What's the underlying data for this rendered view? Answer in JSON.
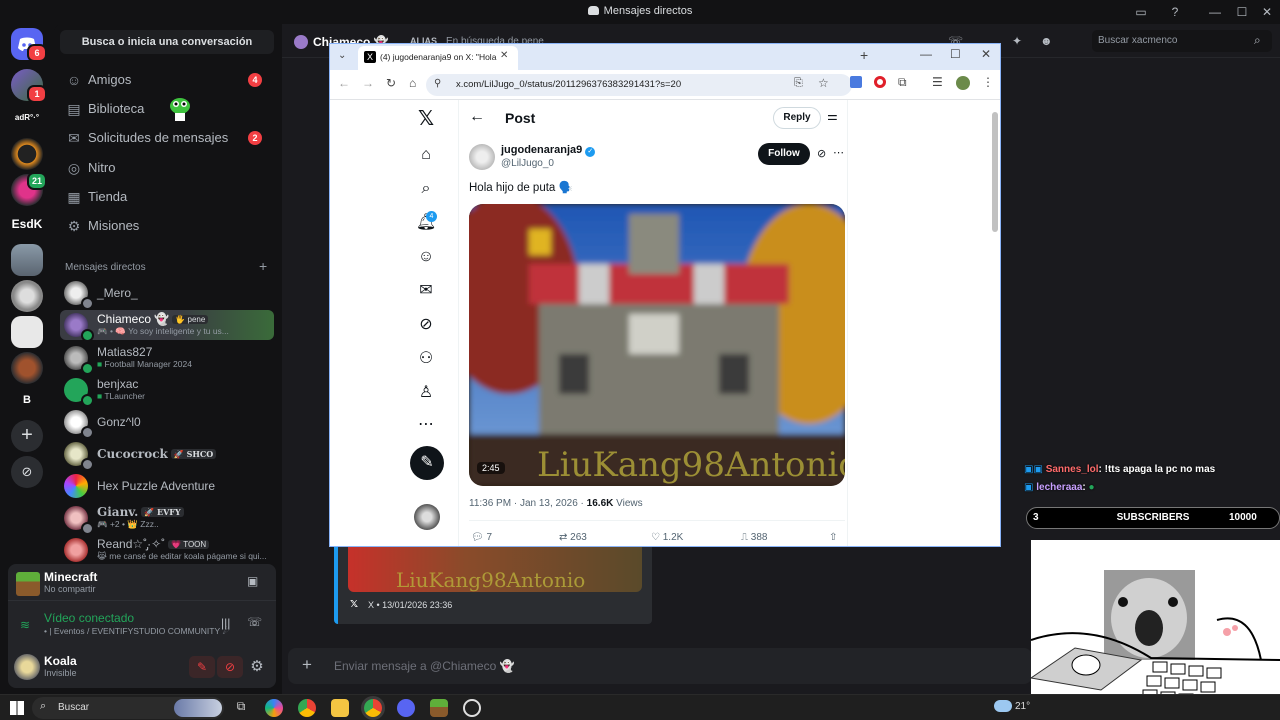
{
  "window": {
    "title": "Mensajes directos"
  },
  "rail": {
    "badges": [
      "6",
      "1",
      "21"
    ],
    "labels": [
      "adR°·°",
      "EsdK",
      "B"
    ]
  },
  "sidebar": {
    "search_label": "Busca o inicia una conversación",
    "nav": [
      {
        "label": "Amigos",
        "badge": "4"
      },
      {
        "label": "Biblioteca"
      },
      {
        "label": "Solicitudes de mensajes",
        "badge": "2"
      },
      {
        "label": "Nitro"
      },
      {
        "label": "Tienda"
      },
      {
        "label": "Misiones"
      }
    ],
    "dm_header": "Mensajes directos",
    "dms": [
      {
        "name": "_Mero_"
      },
      {
        "name": "Chiameco 👻",
        "tag": "🖐 pene",
        "sub": "🎮 • 🧠 Yo soy inteligente y tu us..."
      },
      {
        "name": "Matias827",
        "sub": "Football Manager 2024"
      },
      {
        "name": "benjxac",
        "sub": "TLauncher"
      },
      {
        "name": "Gonz^l0"
      },
      {
        "name": "Cucocrock",
        "tag": "🚀 SHCO"
      },
      {
        "name": "Hex Puzzle Adventure"
      },
      {
        "name": "Gianv.",
        "tag": "🚀 EVFY",
        "sub": "🎮 +2 • 👑 Zzz.."
      },
      {
        "name": "Reand☆˚̡·✧˚",
        "tag": "💗 TOON",
        "sub": "😹 me cansé de editar koala págame si qui..."
      }
    ]
  },
  "panel": {
    "game": "Minecraft",
    "game_sub": "No compartir",
    "voice_title": "Vídeo conectado",
    "voice_sub": "• | Eventos / EVENTIFYSTUDIO COMMUNITY ☄",
    "user": "Koala",
    "status": "Invisible"
  },
  "main": {
    "channel_name": "Chiameco 👻",
    "alias_label": "ALIAS",
    "alias_value": "En búsqueda de pene",
    "search_placeholder": "Buscar xacmenco",
    "message_placeholder": "Enviar mensaje a @Chiameco 👻",
    "embed_footer": "X • 13/01/2026 23:36",
    "embed_watermark": "LiuKang98Antonio"
  },
  "browser": {
    "tab_title": "(4) jugodenaranja9 on X: \"Hola",
    "url": "x.com/LilJugo_0/status/2011296376383291431?s=20",
    "page_title": "Post",
    "reply_label": "Reply",
    "author_name": "jugodenaranja9",
    "author_handle": "@LilJugo_0",
    "follow_label": "Follow",
    "tweet_text": "Hola hijo de puta 🗣️",
    "video_duration": "2:45",
    "video_watermark": "LiuKang98Antonio",
    "timestamp": "11:36 PM · Jan 13, 2026 ·",
    "views_count": "16.6K",
    "views_label": "Views",
    "notif_badge": "4",
    "actions": {
      "replies": "7",
      "reposts": "263",
      "likes": "1.2K",
      "bookmarks": "388"
    }
  },
  "overlay": {
    "chat": [
      {
        "user": "Sannes_lol",
        "text": ": !tts apaga la pc no mas"
      },
      {
        "user": "lecheraaa",
        "text": ":"
      }
    ],
    "subs_left": "3",
    "subs_label": "SUBSCRIBERS",
    "subs_goal": "10000"
  },
  "taskbar": {
    "search_label": "Buscar",
    "temp": "21°"
  },
  "colors": {
    "accent": "#1d9bf0",
    "discord_red": "#f23f43",
    "online": "#23a55a",
    "voice_green": "#23a55a"
  }
}
